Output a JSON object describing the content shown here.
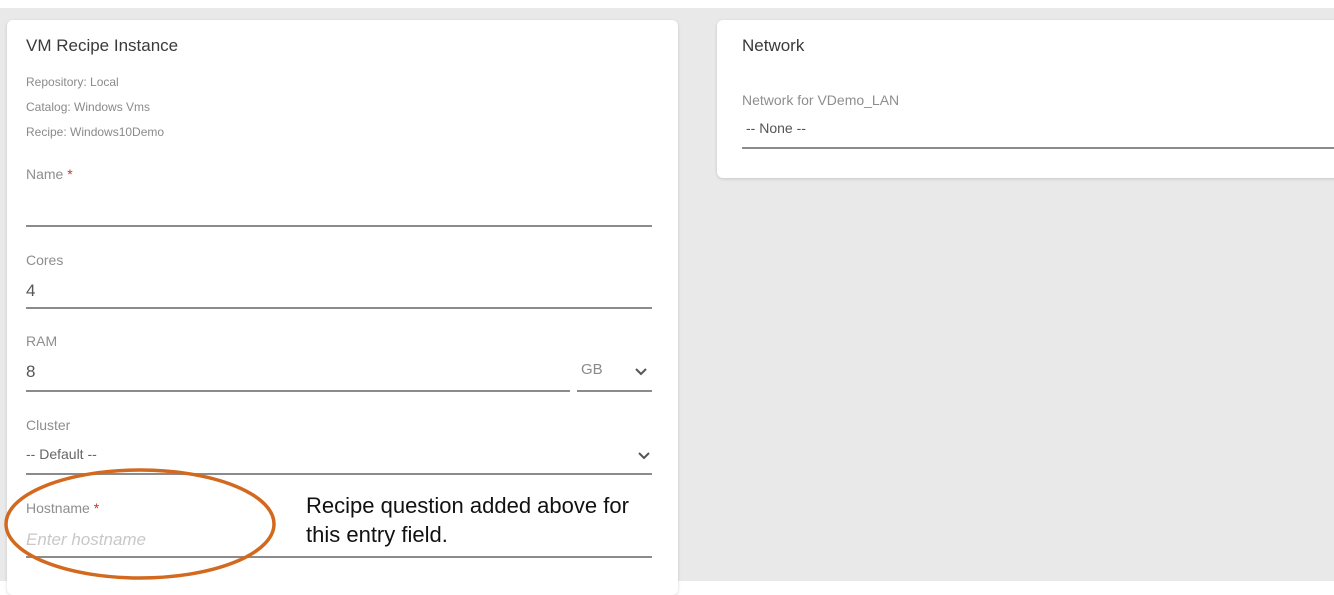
{
  "vm_card": {
    "title": "VM Recipe Instance",
    "repository": "Repository: Local",
    "catalog": "Catalog: Windows Vms",
    "recipe": "Recipe: Windows10Demo",
    "name": {
      "label": "Name",
      "required": "*",
      "value": ""
    },
    "cores": {
      "label": "Cores",
      "value": "4"
    },
    "ram": {
      "label": "RAM",
      "value": "8",
      "unit": "GB"
    },
    "cluster": {
      "label": "Cluster",
      "value": "-- Default --"
    },
    "hostname": {
      "label": "Hostname",
      "required": "*",
      "placeholder": "Enter hostname",
      "value": ""
    }
  },
  "network_card": {
    "title": "Network",
    "field_label": "Network for VDemo_LAN",
    "value": "-- None --"
  },
  "annotation": {
    "text": "Recipe question added above for this entry field.",
    "color": "#d2691e"
  },
  "icons": {
    "chevron": "chevron-down-icon"
  }
}
